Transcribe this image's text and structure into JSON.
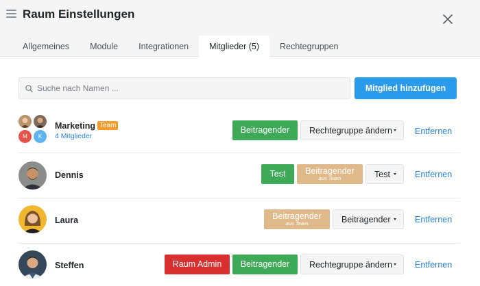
{
  "header": {
    "title": "Raum Einstellungen",
    "tabs": [
      {
        "label": "Allgemeines"
      },
      {
        "label": "Module"
      },
      {
        "label": "Integrationen"
      },
      {
        "label": "Mitglieder (5)",
        "active": true
      },
      {
        "label": "Rechtegruppen"
      }
    ]
  },
  "search": {
    "placeholder": "Suche nach Namen ..."
  },
  "add_button": "Mitglied hinzufügen",
  "remove_label": "Entfernen",
  "colors": {
    "accent": "#2a9bea",
    "green": "#3ea956",
    "red": "#d82f2f",
    "tan": "#e0b98a",
    "team_badge": "#f39c2c"
  },
  "members": [
    {
      "name": "Marketing",
      "badge": "Team",
      "sub": "4 Mitglieder",
      "group_avatars": [
        "M",
        "K"
      ],
      "tags": [
        "Beitragender"
      ],
      "dropdown": "Rechtegruppe ändern"
    },
    {
      "name": "Dennis",
      "tags": [
        "Test"
      ],
      "team_tag": {
        "label": "Beitragender",
        "sub": "aus Team"
      },
      "dropdown": "Test"
    },
    {
      "name": "Laura",
      "team_tag": {
        "label": "Beitragender",
        "sub": "aus Team"
      },
      "dropdown": "Beitragender"
    },
    {
      "name": "Steffen",
      "tags": [
        "Raum Admin",
        "Beitragender"
      ],
      "dropdown": "Rechtegruppe ändern"
    }
  ]
}
